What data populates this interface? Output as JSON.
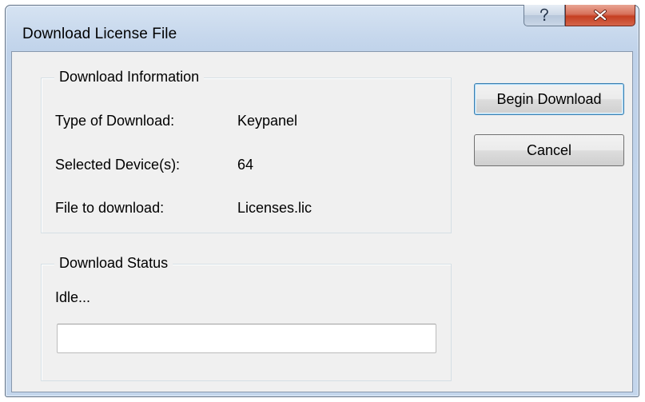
{
  "window": {
    "title": "Download License File",
    "help_icon": "help-question-icon",
    "close_icon": "close-x-icon"
  },
  "info_group": {
    "legend": "Download Information",
    "rows": [
      {
        "label": "Type of Download:",
        "value": "Keypanel"
      },
      {
        "label": "Selected Device(s):",
        "value": "64"
      },
      {
        "label": "File to download:",
        "value": "Licenses.lic"
      }
    ]
  },
  "status_group": {
    "legend": "Download Status",
    "status_text": "Idle...",
    "progress": 0
  },
  "buttons": {
    "begin_download": "Begin Download",
    "cancel": "Cancel"
  },
  "colors": {
    "title_bar": "#c6d7ec",
    "close_button": "#c53f22",
    "dialog_face": "#f0f0f0",
    "default_button_border": "#3c7fb1"
  }
}
